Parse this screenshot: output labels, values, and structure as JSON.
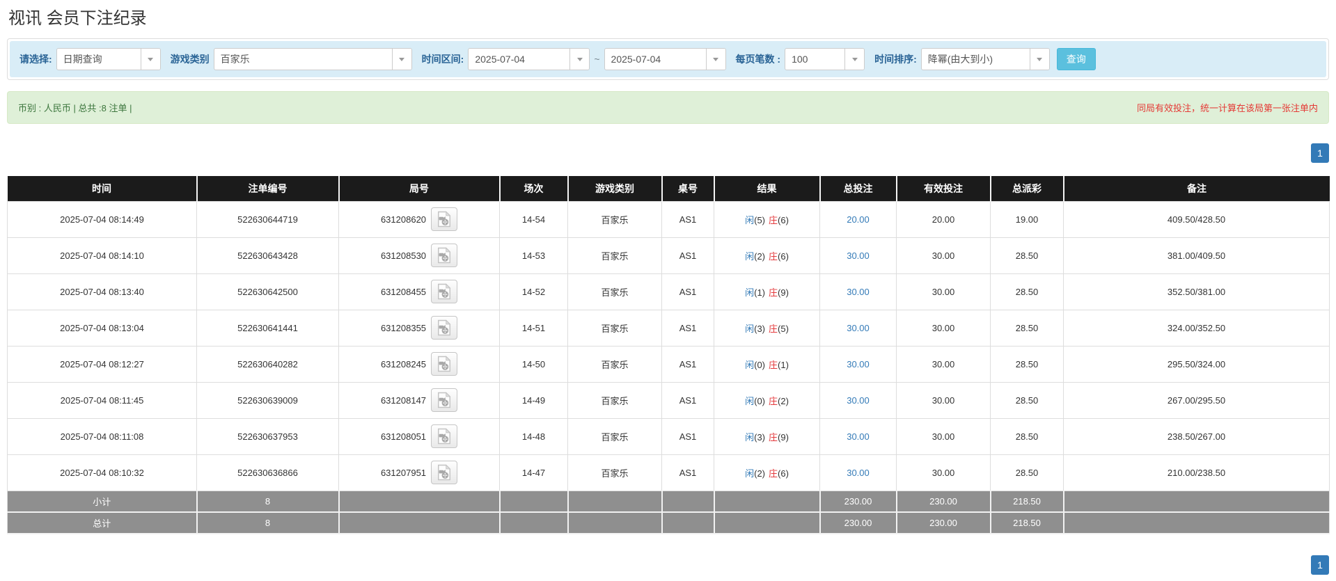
{
  "page": {
    "title": "视讯 会员下注纪录"
  },
  "filters": {
    "select_label": "请选择:",
    "select_value": "日期查询",
    "game_label": "游戏类别",
    "game_value": "百家乐",
    "range_label": "时间区间:",
    "date_from": "2025-07-04",
    "range_sep": "~",
    "date_to": "2025-07-04",
    "page_size_label": "每页笔数 :",
    "page_size_value": "100",
    "sort_label": "时间排序:",
    "sort_value": "降幂(由大到小)",
    "search_button": "查询"
  },
  "summary": {
    "left": "币别 : 人民币 | 总共 :8 注单 |",
    "right": "同局有效投注，统一计算在该局第一张注单内"
  },
  "pagination": {
    "page": "1"
  },
  "table": {
    "headers": [
      "时间",
      "注单编号",
      "局号",
      "场次",
      "游戏类别",
      "桌号",
      "结果",
      "总投注",
      "有效投注",
      "总派彩",
      "备注"
    ],
    "rows": [
      {
        "time": "2025-07-04 08:14:49",
        "bet_id": "522630644719",
        "round": "631208620",
        "session": "14-54",
        "game": "百家乐",
        "table": "AS1",
        "player": "闲",
        "player_n": "(5)",
        "banker": "庄",
        "banker_n": "(6)",
        "total_bet": "20.00",
        "valid_bet": "20.00",
        "payout": "19.00",
        "remark": "409.50/428.50"
      },
      {
        "time": "2025-07-04 08:14:10",
        "bet_id": "522630643428",
        "round": "631208530",
        "session": "14-53",
        "game": "百家乐",
        "table": "AS1",
        "player": "闲",
        "player_n": "(2)",
        "banker": "庄",
        "banker_n": "(6)",
        "total_bet": "30.00",
        "valid_bet": "30.00",
        "payout": "28.50",
        "remark": "381.00/409.50"
      },
      {
        "time": "2025-07-04 08:13:40",
        "bet_id": "522630642500",
        "round": "631208455",
        "session": "14-52",
        "game": "百家乐",
        "table": "AS1",
        "player": "闲",
        "player_n": "(1)",
        "banker": "庄",
        "banker_n": "(9)",
        "total_bet": "30.00",
        "valid_bet": "30.00",
        "payout": "28.50",
        "remark": "352.50/381.00"
      },
      {
        "time": "2025-07-04 08:13:04",
        "bet_id": "522630641441",
        "round": "631208355",
        "session": "14-51",
        "game": "百家乐",
        "table": "AS1",
        "player": "闲",
        "player_n": "(3)",
        "banker": "庄",
        "banker_n": "(5)",
        "total_bet": "30.00",
        "valid_bet": "30.00",
        "payout": "28.50",
        "remark": "324.00/352.50"
      },
      {
        "time": "2025-07-04 08:12:27",
        "bet_id": "522630640282",
        "round": "631208245",
        "session": "14-50",
        "game": "百家乐",
        "table": "AS1",
        "player": "闲",
        "player_n": "(0)",
        "banker": "庄",
        "banker_n": "(1)",
        "total_bet": "30.00",
        "valid_bet": "30.00",
        "payout": "28.50",
        "remark": "295.50/324.00"
      },
      {
        "time": "2025-07-04 08:11:45",
        "bet_id": "522630639009",
        "round": "631208147",
        "session": "14-49",
        "game": "百家乐",
        "table": "AS1",
        "player": "闲",
        "player_n": "(0)",
        "banker": "庄",
        "banker_n": "(2)",
        "total_bet": "30.00",
        "valid_bet": "30.00",
        "payout": "28.50",
        "remark": "267.00/295.50"
      },
      {
        "time": "2025-07-04 08:11:08",
        "bet_id": "522630637953",
        "round": "631208051",
        "session": "14-48",
        "game": "百家乐",
        "table": "AS1",
        "player": "闲",
        "player_n": "(3)",
        "banker": "庄",
        "banker_n": "(9)",
        "total_bet": "30.00",
        "valid_bet": "30.00",
        "payout": "28.50",
        "remark": "238.50/267.00"
      },
      {
        "time": "2025-07-04 08:10:32",
        "bet_id": "522630636866",
        "round": "631207951",
        "session": "14-47",
        "game": "百家乐",
        "table": "AS1",
        "player": "闲",
        "player_n": "(2)",
        "banker": "庄",
        "banker_n": "(6)",
        "total_bet": "30.00",
        "valid_bet": "30.00",
        "payout": "28.50",
        "remark": "210.00/238.50"
      }
    ],
    "subtotal": {
      "label": "小计",
      "count": "8",
      "total_bet": "230.00",
      "valid_bet": "230.00",
      "payout": "218.50"
    },
    "total": {
      "label": "总计",
      "count": "8",
      "total_bet": "230.00",
      "valid_bet": "230.00",
      "payout": "218.50"
    }
  },
  "colors": {
    "accent_button": "#5bc0de",
    "link_blue": "#337ab7",
    "player_blue": "#337ab7",
    "banker_red": "#e4393c",
    "header_bg": "#1b1b1b",
    "summary_row_bg": "#8f8f8f",
    "filter_bg": "#d9edf7",
    "alert_bg": "#dff0d8",
    "alert_text": "#3c763d",
    "alert_warning_text": "#e53935"
  }
}
